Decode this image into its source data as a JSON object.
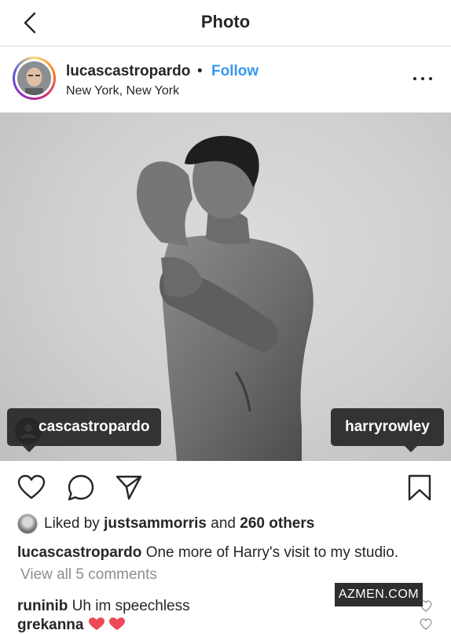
{
  "nav": {
    "title": "Photo",
    "back_icon": "chevron-left-icon"
  },
  "post": {
    "username": "lucascastropardo",
    "separator": "•",
    "follow_label": "Follow",
    "location": "New York, New York",
    "more_icon": "more-horizontal-icon"
  },
  "tags": {
    "left": "cascastropardo",
    "right": "harryrowley"
  },
  "actions": [
    "heart-icon",
    "comment-icon",
    "share-icon",
    "bookmark-icon"
  ],
  "likes": {
    "prefix": "Liked by",
    "user": "justsammorris",
    "conj": "and",
    "others": "260 others"
  },
  "caption": {
    "user": "lucascastropardo",
    "text": "One more of Harry's visit to my studio."
  },
  "view_all": "View all 5 comments",
  "comments": [
    {
      "user": "runinib",
      "text": "Uh im speechless"
    },
    {
      "user": "grekanna",
      "text": ""
    }
  ],
  "watermark": "AZMEN.COM",
  "colors": {
    "link": "#3897f0",
    "text": "#262626",
    "muted": "#8e8e8e",
    "tag_bg": "#262626",
    "heart": "#ed4956"
  }
}
